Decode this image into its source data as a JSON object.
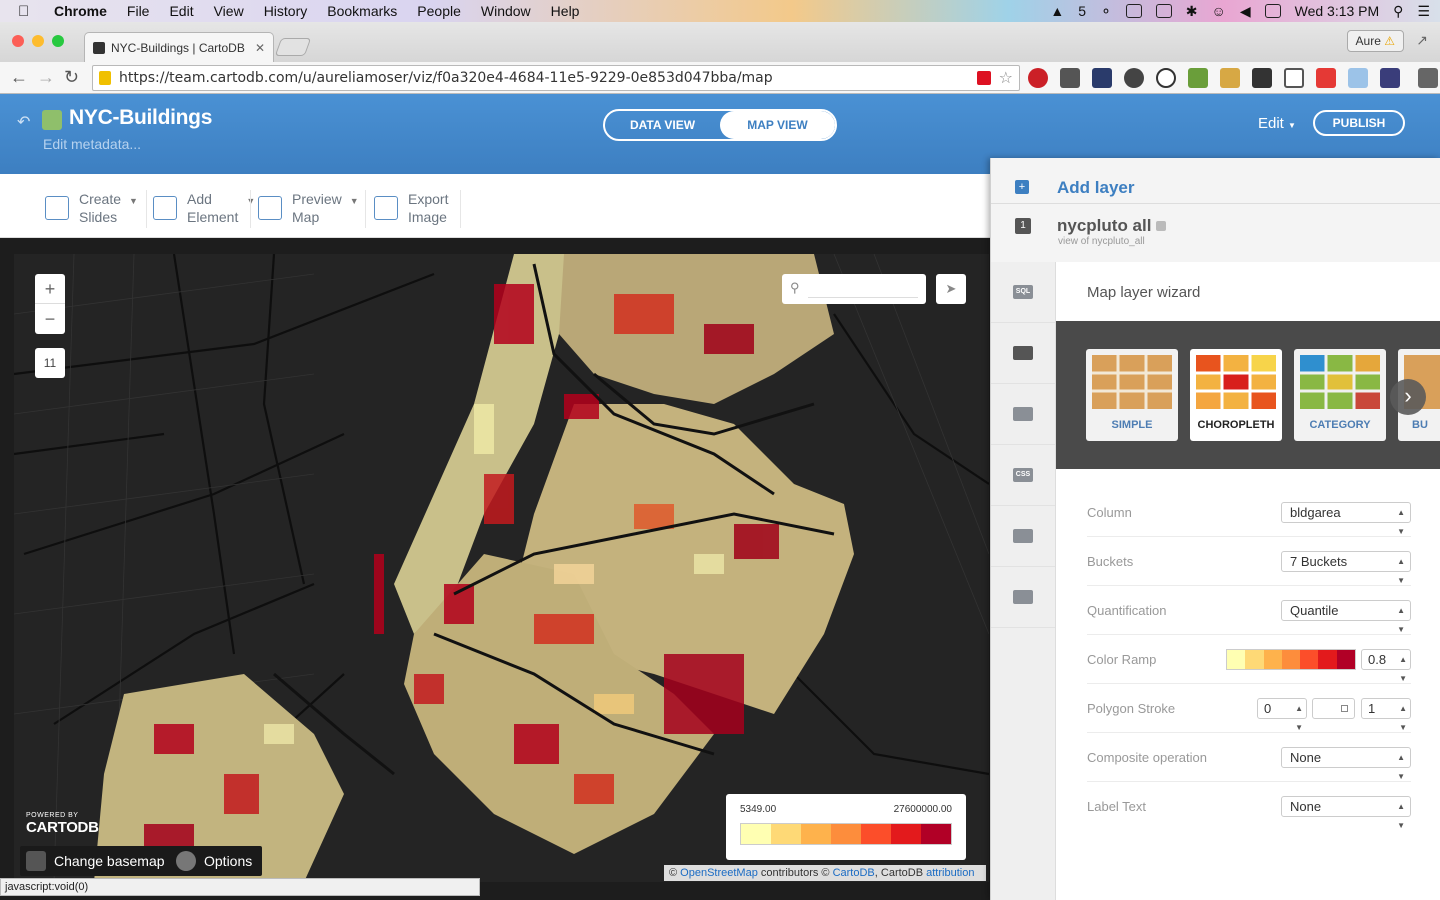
{
  "os_menubar": {
    "app": "Chrome",
    "menus": [
      "File",
      "Edit",
      "View",
      "History",
      "Bookmarks",
      "People",
      "Window",
      "Help"
    ],
    "right_status": {
      "badge_count": "5",
      "clock": "Wed 3:13 PM"
    }
  },
  "browser": {
    "tab_title": "NYC-Buildings | CartoDB",
    "url": "https://team.cartodb.com/u/aureliamoser/viz/f0a320e4-4684-11e5-9229-0e853d047bba/map",
    "profile_name": "Aure",
    "status_text": "javascript:void(0)"
  },
  "header": {
    "title": "NYC-Buildings",
    "edit_metadata": "Edit metadata...",
    "data_view": "DATA VIEW",
    "map_view": "MAP VIEW",
    "edit_menu": "Edit",
    "publish": "PUBLISH"
  },
  "toolbar": {
    "create_slides": [
      "Create",
      "Slides"
    ],
    "add_element": [
      "Add",
      "Element"
    ],
    "preview_map": [
      "Preview",
      "Map"
    ],
    "export_image": [
      "Export",
      "Image"
    ]
  },
  "map": {
    "zoom_in": "+",
    "zoom_out": "−",
    "zoom_level": "11",
    "search_placeholder": "",
    "powered_by": "POWERED BY",
    "brand": "CARTODB",
    "change_basemap": "Change basemap",
    "options": "Options",
    "legend_min": "5349.00",
    "legend_max": "27600000.00",
    "legend_colors": [
      "#FFFFB2",
      "#FED976",
      "#FEB24C",
      "#FD8D3C",
      "#FC4E2A",
      "#E31A1C",
      "#B10026"
    ],
    "attribution": {
      "prefix": "© ",
      "osm": "OpenStreetMap",
      "mid": " contributors © ",
      "cartodb": "CartoDB",
      "mid2": ", CartoDB ",
      "attribution": "attribution"
    }
  },
  "panel": {
    "add_layer": "Add layer",
    "layer_number": "1",
    "layer_name": "nycpluto all",
    "layer_sub": "view of nycpluto_all",
    "side_icons": [
      "sql-icon",
      "wizard-icon",
      "infowindow-icon",
      "css-icon",
      "legend-icon",
      "widgets-icon"
    ],
    "side_labels": [
      "SQL",
      "",
      "",
      "CSS",
      "",
      ""
    ],
    "wizard_title": "Map layer wizard",
    "visualizations": [
      {
        "label": "SIMPLE"
      },
      {
        "label": "CHOROPLETH",
        "selected": true
      },
      {
        "label": "CATEGORY"
      },
      {
        "label": "BU"
      }
    ],
    "fields": {
      "column": {
        "label": "Column",
        "value": "bldgarea"
      },
      "buckets": {
        "label": "Buckets",
        "value": "7 Buckets"
      },
      "quantification": {
        "label": "Quantification",
        "value": "Quantile"
      },
      "color_ramp": {
        "label": "Color Ramp",
        "opacity": "0.8"
      },
      "polygon_stroke": {
        "label": "Polygon Stroke",
        "width": "0",
        "opacity": "1"
      },
      "composite": {
        "label": "Composite operation",
        "value": "None"
      },
      "label_text": {
        "label": "Label Text",
        "value": "None"
      }
    }
  },
  "colors": {
    "brand_blue": "#3d7fc1",
    "map_bg": "#242424",
    "land": "#c9c08a"
  }
}
